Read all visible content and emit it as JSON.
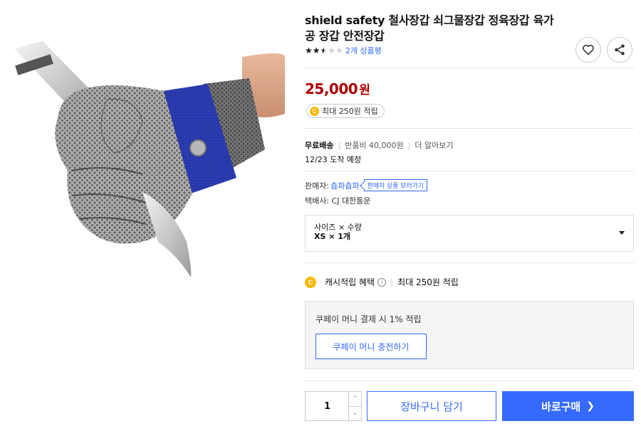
{
  "product": {
    "title": "shield safety 철사장갑 쇠그물장갑 정육장갑 육가공 장갑 안전장갑",
    "rating": 2.5,
    "rating_max": 5,
    "review_text": "2개 상품평",
    "image_alt": "chainmail glove holding knife"
  },
  "price": {
    "amount": "25,000",
    "unit": "원",
    "cash_badge_icon": "C",
    "cash_badge": "최대 250원 적립"
  },
  "shipping": {
    "free_label": "무료배송",
    "return_fee": "반품비 40,000원",
    "more": "더 알아보기",
    "arrival": "12/23 도착 예정"
  },
  "seller": {
    "label": "판매자:",
    "name": "츕파츕파",
    "products_button": "판매자 상품 보러가기",
    "carrier": "택배사: CJ 대한통운"
  },
  "option": {
    "label": "사이즈 × 수량",
    "value": "XS × 1개"
  },
  "cashback": {
    "icon": "C",
    "label": "캐시적립 혜택",
    "info_icon": "i",
    "value": "최대 250원 적립"
  },
  "coupay": {
    "text": "쿠페이 머니 결제 시 1% 적립",
    "button": "쿠페이 머니 충전하기"
  },
  "purchase": {
    "quantity": "1",
    "up_symbol": "⌃",
    "down_symbol": "⌄",
    "cart_button": "장바구니 담기",
    "buy_button": "바로구매",
    "buy_chevron": "❯"
  },
  "colors": {
    "accent": "#346aff",
    "price": "#ae0000",
    "coin": "#f6b800"
  }
}
